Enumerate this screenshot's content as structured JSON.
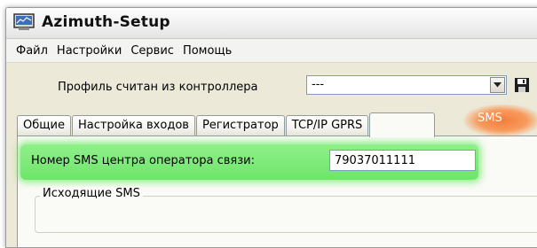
{
  "window": {
    "title": "Azimuth-Setup",
    "icon": "app-window-icon"
  },
  "menu": {
    "items": [
      "Файл",
      "Настройки",
      "Сервис",
      "Помощь"
    ]
  },
  "profile": {
    "label": "Профиль считан из контроллера",
    "combo_value": "---",
    "save_icon": "floppy-disk-icon"
  },
  "tabs": [
    "Общие",
    "Настройка входов",
    "Регистратор",
    "TCP/IP GPRS",
    "SMS"
  ],
  "active_tab": "SMS",
  "sms": {
    "center_label": "Номер SMS центра оператора связи:",
    "center_value": "79037011111",
    "outgoing_group": "Исходящие SMS"
  },
  "highlights": {
    "tab": "#f5783a",
    "row": "#7ee87a"
  }
}
